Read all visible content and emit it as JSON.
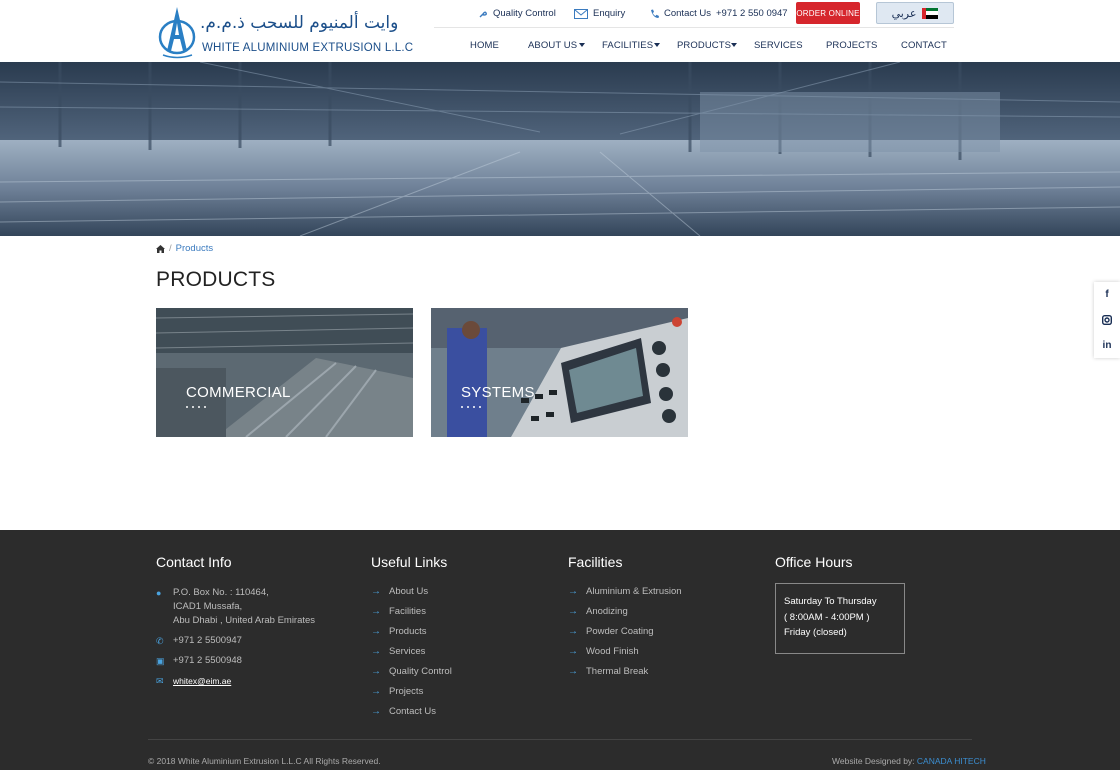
{
  "brand": {
    "name_ar": "وايت ألمنيوم للسحب ذ.م.م.",
    "name_en": "WHITE ALUMINIUM EXTRUSION L.L.C"
  },
  "topbar": {
    "quality_control": "Quality Control",
    "enquiry": "Enquiry",
    "contact_prefix": "Contact Us",
    "contact_phone": "+971 2 550 0947",
    "order_online": "ORDER ONLINE",
    "language": "عربي"
  },
  "nav": {
    "items": [
      "HOME",
      "ABOUT US",
      "FACILITIES",
      "PRODUCTS",
      "SERVICES",
      "PROJECTS",
      "CONTACT"
    ]
  },
  "breadcrumb": {
    "current": "Products"
  },
  "page": {
    "title": "PRODUCTS"
  },
  "cards": [
    {
      "label": "COMMERCIAL"
    },
    {
      "label": "SYSTEMS"
    }
  ],
  "footer": {
    "contact": {
      "heading": "Contact Info",
      "address_line1": "P.O. Box No. : 110464,",
      "address_line2": "ICAD1 Mussafa,",
      "address_line3": "Abu Dhabi , United Arab Emirates",
      "phone": "+971 2 5500947",
      "fax": "+971 2 5500948",
      "email": "whitex@eim.ae"
    },
    "useful_links": {
      "heading": "Useful Links",
      "items": [
        "About Us",
        "Facilities",
        "Products",
        "Services",
        "Quality Control",
        "Projects",
        "Contact Us"
      ]
    },
    "facilities": {
      "heading": "Facilities",
      "items": [
        "Aluminium & Extrusion",
        "Anodizing",
        "Powder Coating",
        "Wood Finish",
        "Thermal Break"
      ]
    },
    "office_hours": {
      "heading": "Office Hours",
      "line1": "Saturday To Thursday",
      "line2": "( 8:00AM - 4:00PM )",
      "line3": "Friday (closed)"
    },
    "copyright": "© 2018 White Aluminium Extrusion L.L.C All Rights Reserved.",
    "credit_prefix": "Website Designed by:",
    "credit_brand": "CANADA HITECH"
  },
  "colors": {
    "navy": "#1a2f55",
    "accent_blue": "#3b7bbf",
    "order_red": "#d6262c",
    "footer_bg": "#2c2c2c"
  }
}
